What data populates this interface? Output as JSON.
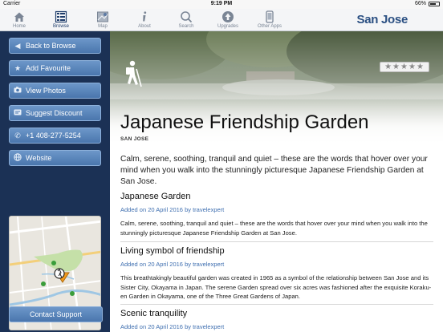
{
  "status_bar": {
    "carrier": "Carrier",
    "time": "9:19 PM",
    "battery": "66%"
  },
  "nav": {
    "tabs": [
      {
        "label": "Home",
        "icon": "home-icon"
      },
      {
        "label": "Browse",
        "icon": "browse-grid-icon",
        "active": true
      },
      {
        "label": "Map",
        "icon": "map-icon"
      },
      {
        "label": "About",
        "icon": "info-icon"
      },
      {
        "label": "Search",
        "icon": "search-icon"
      },
      {
        "label": "Upgrades",
        "icon": "upgrade-icon"
      },
      {
        "label": "Other Apps",
        "icon": "phone-icon"
      }
    ],
    "brand": "San Jose"
  },
  "sidebar": {
    "buttons": [
      {
        "label": "Back to Browse",
        "icon": "arrow-left-icon"
      },
      {
        "label": "Add Favourite",
        "icon": "star-icon"
      },
      {
        "label": "View Photos",
        "icon": "camera-icon"
      },
      {
        "label": "Suggest Discount",
        "icon": "tag-icon"
      },
      {
        "label": "+1 408-277-5254",
        "icon": "phone-call-icon"
      },
      {
        "label": "Website",
        "icon": "globe-icon"
      }
    ],
    "map_label": "Sharks Ice",
    "support": "Contact Support"
  },
  "listing": {
    "rating": "★★★★★",
    "title": "Japanese Friendship Garden",
    "city": "SAN JOSE",
    "intro": "Calm, serene, soothing, tranquil and quiet – these are the words that hover over your mind when you walk into the stunningly picturesque Japanese Friendship Garden at San Jose."
  },
  "articles": [
    {
      "heading": "Japanese Garden",
      "meta": "Added on 20 April 2016 by travelexpert",
      "body": "Calm, serene, soothing, tranquil and quiet – these are the words that hover over your mind when you walk into the stunningly picturesque Japanese Friendship Garden at San Jose."
    },
    {
      "heading": "Living symbol of friendship",
      "meta": "Added on 20 April 2016 by travelexpert",
      "body": "This breathtakingly beautiful garden was created in 1965 as a symbol of the relationship between San Jose and its Sister City, Okayama in Japan.  The serene Garden spread over six acres was fashioned after the exquisite Koraku-en Garden in Okayama, one of the Three Great Gardens of Japan."
    },
    {
      "heading": "Scenic tranquility",
      "meta": "Added on 20 April 2016 by travelexpert",
      "body": ""
    }
  ]
}
